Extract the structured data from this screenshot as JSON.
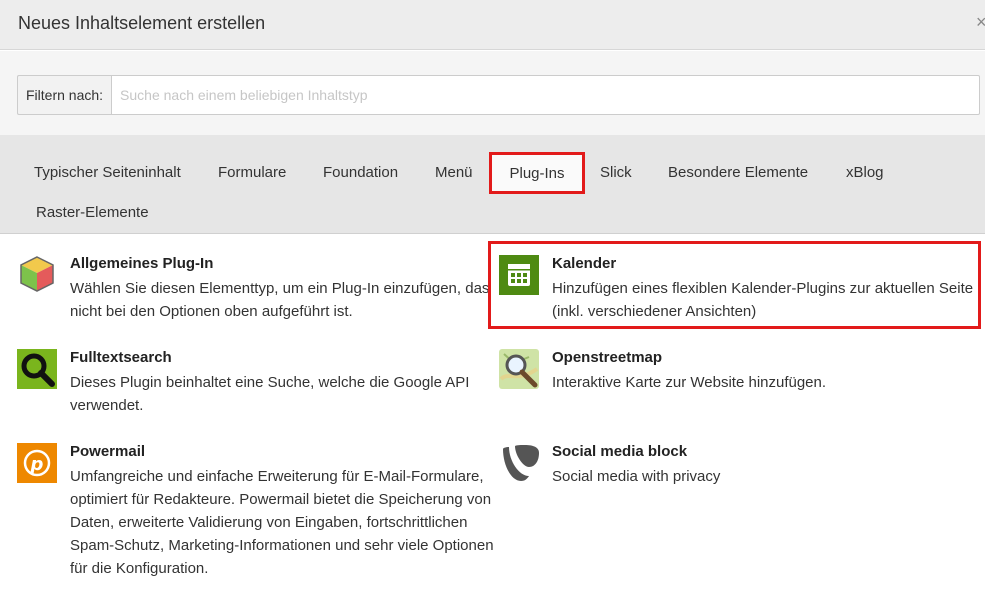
{
  "dialog": {
    "title": "Neues Inhaltselement erstellen",
    "close_icon": "close-icon"
  },
  "filter": {
    "label": "Filtern nach:",
    "placeholder": "Suche nach einem beliebigen Inhaltstyp",
    "value": ""
  },
  "tabs": [
    {
      "label": "Typischer Seiteninhalt"
    },
    {
      "label": "Formulare"
    },
    {
      "label": "Foundation"
    },
    {
      "label": "Menü"
    },
    {
      "label": "Plug-Ins",
      "active": true
    },
    {
      "label": "Slick"
    },
    {
      "label": "Besondere Elemente"
    },
    {
      "label": "xBlog"
    },
    {
      "label": "Raster-Elemente"
    }
  ],
  "items": [
    {
      "name": "Allgemeines Plug-In",
      "description": "Wählen Sie diesen Elementtyp, um ein Plug-In einzufügen, das nicht bei den Optionen oben aufgeführt ist.",
      "icon": "cube-icon"
    },
    {
      "name": "Kalender",
      "description": "Hinzufügen eines flexiblen Kalender-Plugins zur aktuellen Seite (inkl. verschiedener Ansichten)",
      "icon": "calendar-icon"
    },
    {
      "name": "Fulltextsearch",
      "description": "Dieses Plugin beinhaltet eine Suche, welche die Google API verwendet.",
      "icon": "magnifier-icon"
    },
    {
      "name": "Openstreetmap",
      "description": "Interaktive Karte zur Website hinzufügen.",
      "icon": "map-icon"
    },
    {
      "name": "Powermail",
      "description": "Umfangreiche und einfache Erweiterung für E-Mail-Formulare, optimiert für Redakteure. Powermail bietet die Speicherung von Daten, erweiterte Validierung von Eingaben, fortschrittlichen Spam-Schutz, Marketing-Informationen und sehr viele Optionen für die Konfiguration.",
      "icon": "powermail-icon"
    },
    {
      "name": "Social media block",
      "description": "Social media with privacy",
      "icon": "typo3-icon"
    }
  ],
  "colors": {
    "highlight": "#e21a1a",
    "calendar_green": "#4e8a12",
    "search_green": "#7ab51d",
    "powermail_orange": "#ee8800"
  }
}
